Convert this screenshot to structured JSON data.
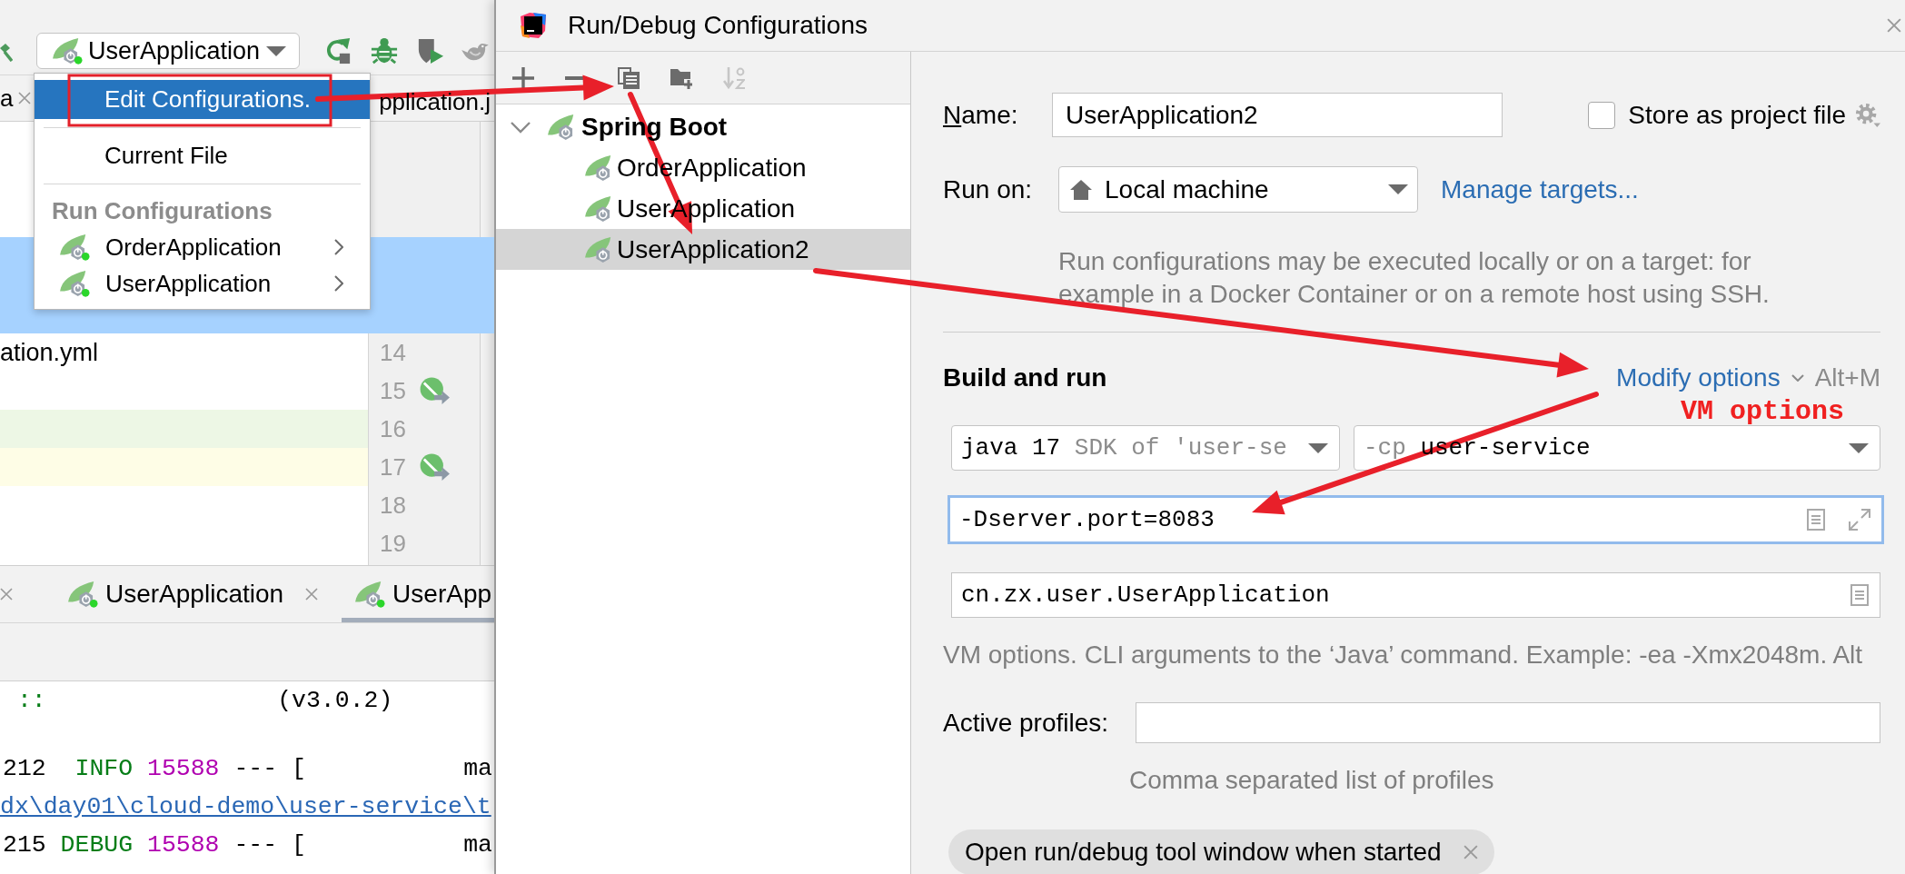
{
  "ide": {
    "run_selector": {
      "label": "UserApplication",
      "running": true
    },
    "editor_tabs": [
      {
        "kind": "tab",
        "label": "a"
      },
      {
        "kind": "cut",
        "label": "pplication.j"
      }
    ],
    "run_menu": [
      {
        "kind": "action",
        "label": "Edit Configurations.",
        "selected": true
      },
      {
        "kind": "separator"
      },
      {
        "kind": "action",
        "label": "Current File",
        "selected": false
      },
      {
        "kind": "separator"
      },
      {
        "kind": "header",
        "label": "Run Configurations"
      },
      {
        "kind": "config",
        "label": "OrderApplication",
        "running": true,
        "selected": false
      },
      {
        "kind": "config",
        "label": "UserApplication",
        "running": true,
        "selected": false
      }
    ],
    "file_label": "ation.yml",
    "gutter": [
      {
        "line": "14",
        "run_marker": false
      },
      {
        "line": "15",
        "run_marker": true
      },
      {
        "line": "16",
        "run_marker": false,
        "color": "#edf7e5"
      },
      {
        "line": "17",
        "run_marker": true,
        "color": "#fefde6"
      },
      {
        "line": "18",
        "run_marker": false
      },
      {
        "line": "19",
        "run_marker": false
      }
    ],
    "run_tabs": [
      {
        "kind": "stub",
        "selected": false
      },
      {
        "kind": "tab",
        "label": "UserApplication",
        "running": true,
        "selected": false
      },
      {
        "kind": "cut",
        "label": "UserApp",
        "running": true,
        "selected": true
      }
    ],
    "console": [
      {
        "segments": [
          {
            "kind": "banner",
            "text": "::"
          },
          {
            "kind": "version",
            "text": "(v3.0.2)"
          }
        ]
      },
      {
        "segments": [
          {
            "kind": "time",
            "text": "212"
          },
          {
            "kind": "level",
            "text": "INFO"
          },
          {
            "kind": "pid",
            "text": "15588"
          },
          {
            "kind": "plain",
            "text": "--- ["
          },
          {
            "kind": "thread",
            "text": "ma"
          }
        ]
      },
      {
        "segments": [
          {
            "kind": "link",
            "text": "dx\\day01\\cloud-demo\\user-service\\t"
          }
        ]
      },
      {
        "segments": [
          {
            "kind": "time",
            "text": "215"
          },
          {
            "kind": "level",
            "text": "DEBUG"
          },
          {
            "kind": "pid",
            "text": "15588"
          },
          {
            "kind": "plain",
            "text": "--- ["
          },
          {
            "kind": "thread",
            "text": "ma"
          }
        ]
      }
    ]
  },
  "dialog": {
    "title": "Run/Debug Configurations",
    "toolbar": [
      {
        "disabled": false
      },
      {
        "disabled": false
      },
      {
        "disabled": false
      },
      {
        "disabled": false
      },
      {
        "disabled": true
      }
    ],
    "tree": [
      {
        "label": "Spring Boot",
        "expanded": true,
        "selected": false,
        "children": [
          {
            "label": "OrderApplication",
            "selected": false
          },
          {
            "label": "UserApplication",
            "selected": false
          },
          {
            "label": "UserApplication2",
            "selected": true
          }
        ]
      }
    ],
    "form": {
      "name": {
        "label": "Name:",
        "value": "UserApplication2"
      },
      "store_as_project_file": {
        "label": "Store as project file",
        "checked": false
      },
      "run_on": {
        "label": "Run on:",
        "value": "Local machine",
        "link": "Manage targets..."
      },
      "run_on_hint": "Run configurations may be executed locally or on a target: for example in a Docker Container or on a remote host using SSH.",
      "build_and_run": {
        "title": "Build and run",
        "modify_options": "Modify options",
        "shortcut": "Alt+M",
        "jdk": {
          "value": "java 17",
          "hint": "SDK of 'user-se"
        },
        "classpath": {
          "flag": "-cp",
          "value": "user-service"
        },
        "vm_options": {
          "value": "-Dserver.port=8083",
          "focused": true
        },
        "main_class": {
          "value": "cn.zx.user.UserApplication"
        },
        "hint": "VM options. CLI arguments to the ‘Java’ command. Example: -ea -Xmx2048m. Alt"
      },
      "active_profiles": {
        "label": "Active profiles:",
        "hint": "Comma separated list of profiles"
      },
      "option_chips": [
        {
          "label": "Open run/debug tool window when started"
        }
      ]
    }
  },
  "annotation": {
    "callout": "VM options"
  }
}
